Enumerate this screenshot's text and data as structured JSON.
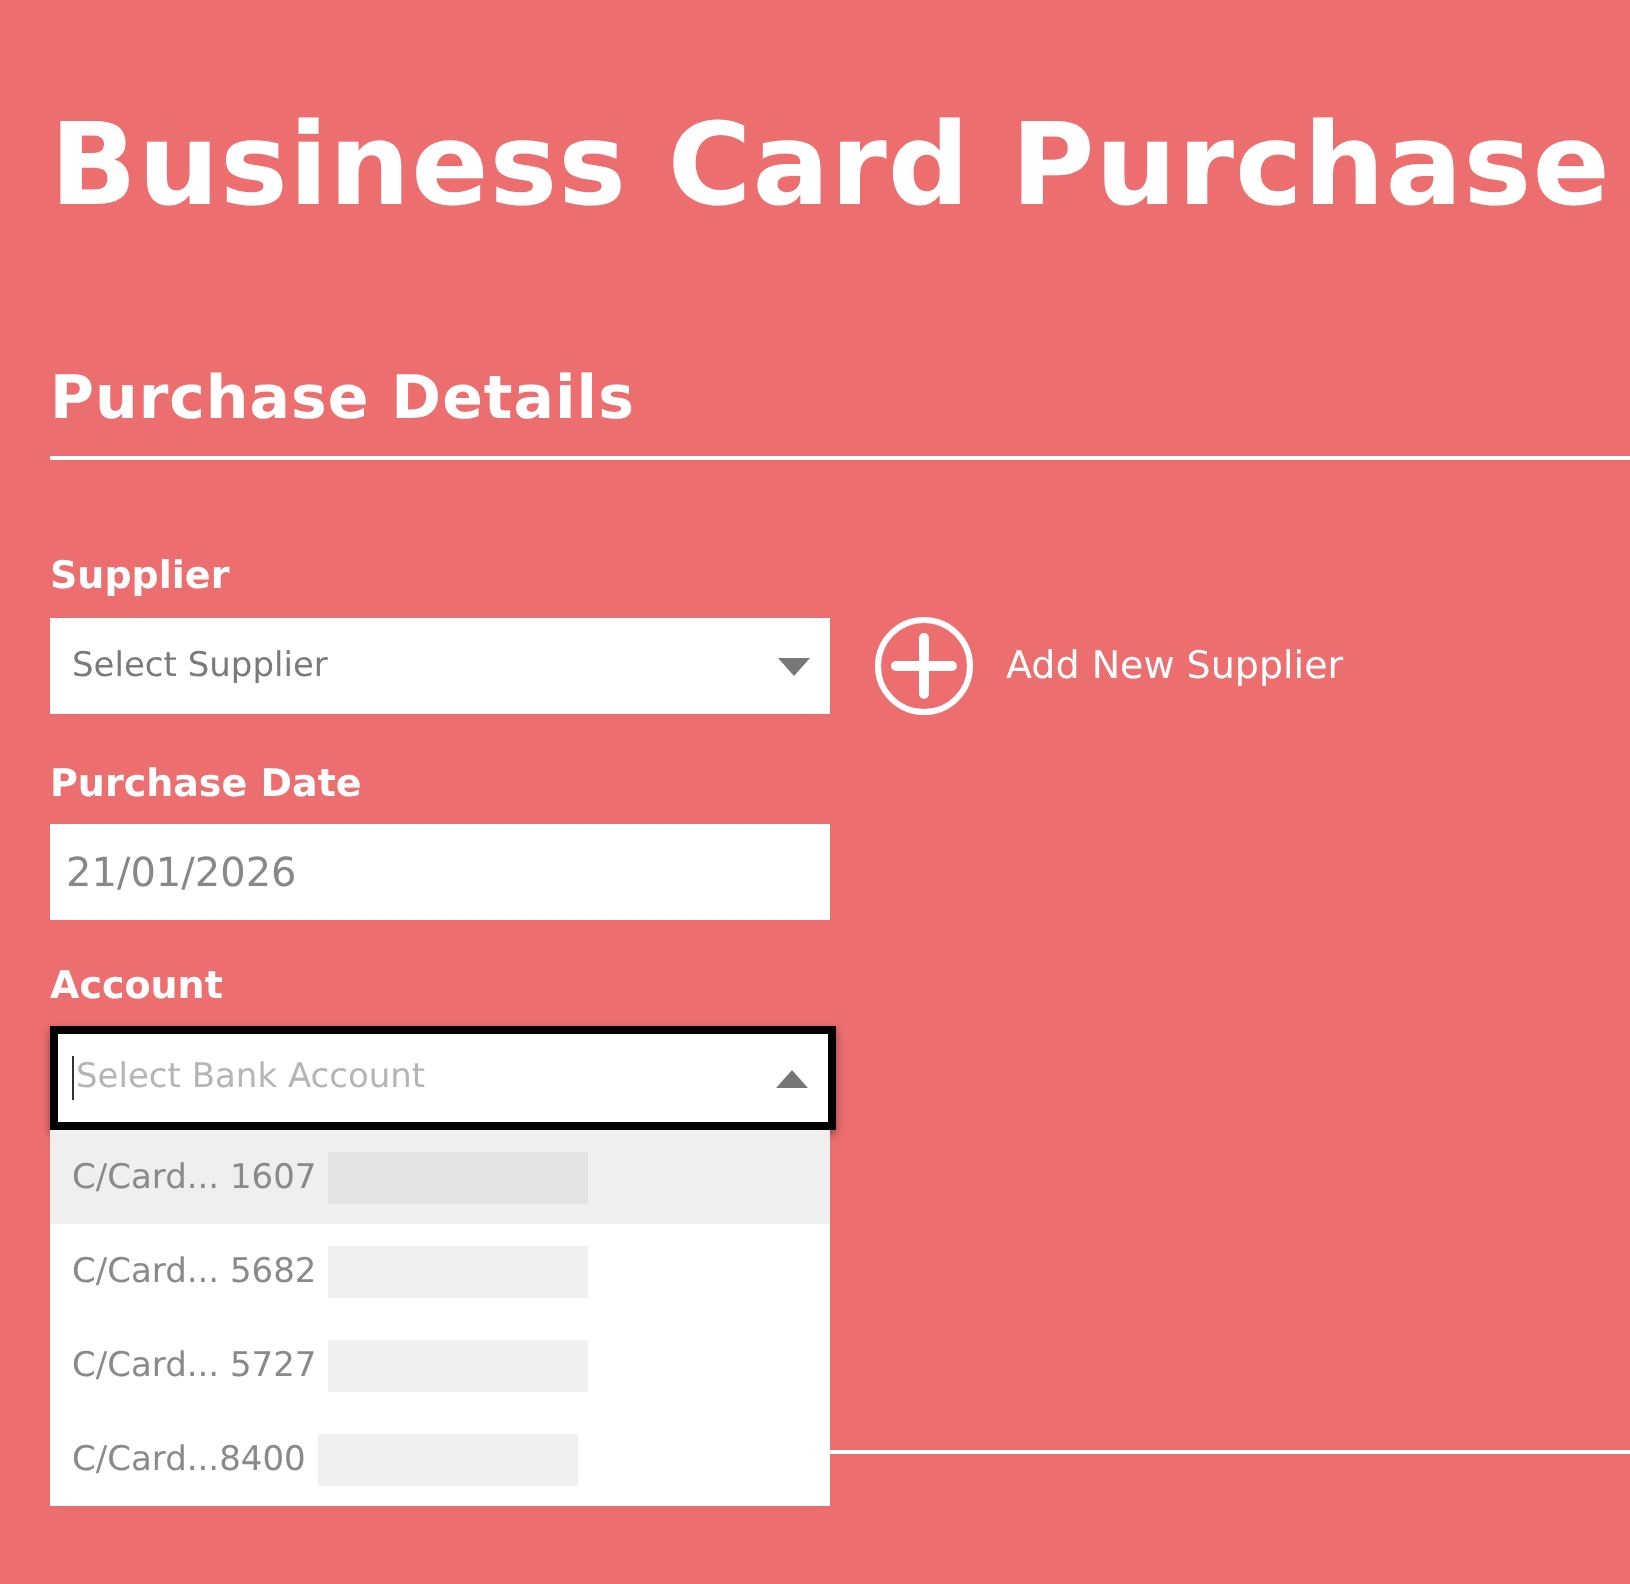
{
  "title": "Business Card Purchase",
  "section": {
    "title": "Purchase Details"
  },
  "supplier": {
    "label": "Supplier",
    "placeholder": "Select Supplier",
    "add_button": "Add New Supplier"
  },
  "purchase_date": {
    "label": "Purchase Date",
    "value": "21/01/2026"
  },
  "account": {
    "label": "Account",
    "placeholder": "Select Bank Account",
    "focused": true,
    "expanded": true,
    "options": [
      {
        "label": "C/Card... 1607",
        "selected": true
      },
      {
        "label": "C/Card... 5682",
        "selected": false
      },
      {
        "label": "C/Card... 5727",
        "selected": false
      },
      {
        "label": "C/Card...8400",
        "selected": false
      }
    ]
  }
}
